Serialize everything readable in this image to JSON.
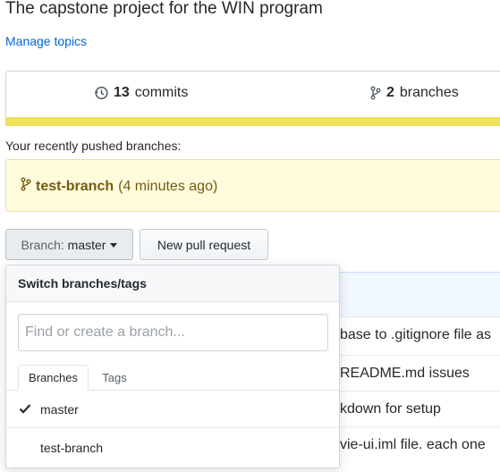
{
  "repo": {
    "description": "The capstone project for the WIN program",
    "manage_topics": "Manage topics"
  },
  "summary": {
    "commits_count": "13",
    "commits_label": "commits",
    "branches_count": "2",
    "branches_label": "branches",
    "language_bar_color": "#f1e05a"
  },
  "recent": {
    "label": "Your recently pushed branches:",
    "branch_name": "test-branch",
    "time": "(4 minutes ago)"
  },
  "toolbar": {
    "branch_prefix": "Branch:",
    "branch_current": "master",
    "new_pr": "New pull request"
  },
  "dropdown": {
    "title": "Switch branches/tags",
    "placeholder": "Find or create a branch...",
    "tabs": [
      "Branches",
      "Tags"
    ],
    "items": [
      {
        "label": "master",
        "selected": true
      },
      {
        "label": "test-branch",
        "selected": false
      }
    ]
  },
  "file_messages": [
    "base to .gitignore file as",
    "README.md issues",
    "kdown for setup",
    "vie-ui.iml file. each one"
  ],
  "icons": {
    "commits": "history-icon",
    "branches": "git-branch-icon",
    "recent_branch": "git-branch-icon",
    "selected": "check-icon"
  }
}
